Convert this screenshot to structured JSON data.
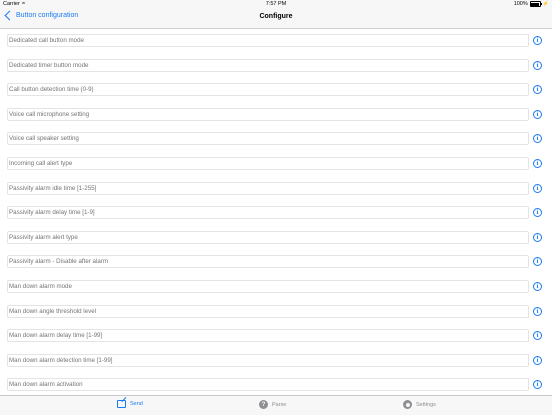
{
  "status_bar": {
    "carrier": "Carrier",
    "time": "7:57 PM",
    "battery": "100%"
  },
  "nav": {
    "back_label": "Button configuration",
    "title": "Configure"
  },
  "settings": [
    {
      "placeholder": "Dedicated call button mode"
    },
    {
      "placeholder": "Dedicated timer button mode"
    },
    {
      "placeholder": "Call button detection time (0-9)"
    },
    {
      "placeholder": "Voice call microphone setting"
    },
    {
      "placeholder": "Voice call speaker setting"
    },
    {
      "placeholder": "Incoming call alert type"
    },
    {
      "placeholder": "Passivity alarm idle time [1-255]"
    },
    {
      "placeholder": "Passivity alarm delay time [1-9]"
    },
    {
      "placeholder": "Passivity alarm alert type"
    },
    {
      "placeholder": "Passivity alarm - Disable after alarm"
    },
    {
      "placeholder": "Man down alarm mode"
    },
    {
      "placeholder": "Man down angle threshold level"
    },
    {
      "placeholder": "Man down alarm delay time [1-99]"
    },
    {
      "placeholder": "Man down alarm detection time [1-99]"
    },
    {
      "placeholder": "Man down alarm activation"
    }
  ],
  "info_glyph": "i",
  "tabs": {
    "send": "Send",
    "parse": "Parse",
    "parse_glyph": "?",
    "settings": "Settings"
  },
  "colors": {
    "accent": "#1a7bf2",
    "inactive": "#8e8e93",
    "placeholder": "#c0c0c6"
  },
  "icons": {
    "back": "chevron-left-icon",
    "info": "info-circle-icon",
    "send": "compose-icon",
    "parse": "question-circle-icon",
    "settings": "gear-icon"
  }
}
